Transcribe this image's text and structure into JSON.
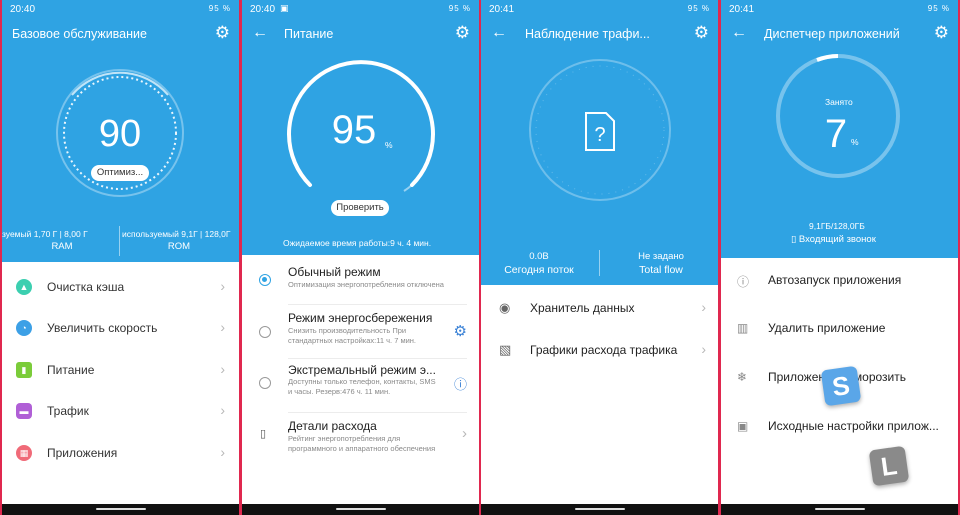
{
  "status_bar": {
    "p1_time": "20:40",
    "p2_time": "20:40",
    "p3_time": "20:41",
    "p4_time": "20:41",
    "battery": "95 %"
  },
  "p1": {
    "title": "Базовое обслуживание",
    "score": "90",
    "optimize_button": "Оптимиз...",
    "ram_usage": "зуемый 1,70 Г | 8,00 Г",
    "ram_label": "RAM",
    "rom_usage": "используемый 9,1Г | 128,0Г",
    "rom_label": "ROM",
    "menu": [
      {
        "label": "Очистка кэша",
        "icon": "flask-icon",
        "color": "#3ccfb0"
      },
      {
        "label": "Увеличить скорость",
        "icon": "speedometer-icon",
        "color": "#3ca0e6"
      },
      {
        "label": "Питание",
        "icon": "battery-icon",
        "color": "#7bcc3a"
      },
      {
        "label": "Трафик",
        "icon": "traffic-icon",
        "color": "#b05fd6"
      },
      {
        "label": "Приложения",
        "icon": "apps-icon",
        "color": "#f06a78"
      }
    ]
  },
  "p2": {
    "title": "Питание",
    "percent": "95",
    "percent_sign": "%",
    "check_button": "Проверить",
    "estimate": "Ожидаемое время работы:9 ч. 4 мин.",
    "modes": [
      {
        "title": "Обычный режим",
        "desc": "Оптимизация энергопотребления отключена"
      },
      {
        "title": "Режим энергосбережения",
        "desc": "Снизить производительность При стандартных настройках:11 ч. 7 мин."
      },
      {
        "title": "Экстремальный режим э...",
        "desc": "Доступны только телефон, контакты, SMS и часы. Резерв:476 ч. 11 мин."
      },
      {
        "title": "Детали расхода",
        "desc": "Рейтинг энергопотребления для программного и аппаратного обеспечения"
      }
    ]
  },
  "p3": {
    "title": "Наблюдение трафи...",
    "today_value": "0.0B",
    "today_label": "Сегодня поток",
    "total_value": "Не задано",
    "total_label": "Total flow",
    "rows": [
      {
        "label": "Хранитель данных",
        "icon": "shield-icon"
      },
      {
        "label": "Графики расхода трафика",
        "icon": "chart-icon"
      }
    ]
  },
  "p4": {
    "title": "Диспетчер приложений",
    "occupied_label": "Занято",
    "percent": "7",
    "percent_sign": "%",
    "storage": "9,1ГБ/128,0ГБ",
    "incoming": "Входящий звонок",
    "rows": [
      {
        "label": "Автозапуск приложения",
        "icon": "info-icon"
      },
      {
        "label": "Удалить приложение",
        "icon": "trash-icon"
      },
      {
        "label": "Приложение заморозить",
        "icon": "snowflake-icon"
      },
      {
        "label": "Исходные настройки прилож...",
        "icon": "lock-icon"
      }
    ]
  },
  "watermark": [
    "S",
    "L"
  ]
}
